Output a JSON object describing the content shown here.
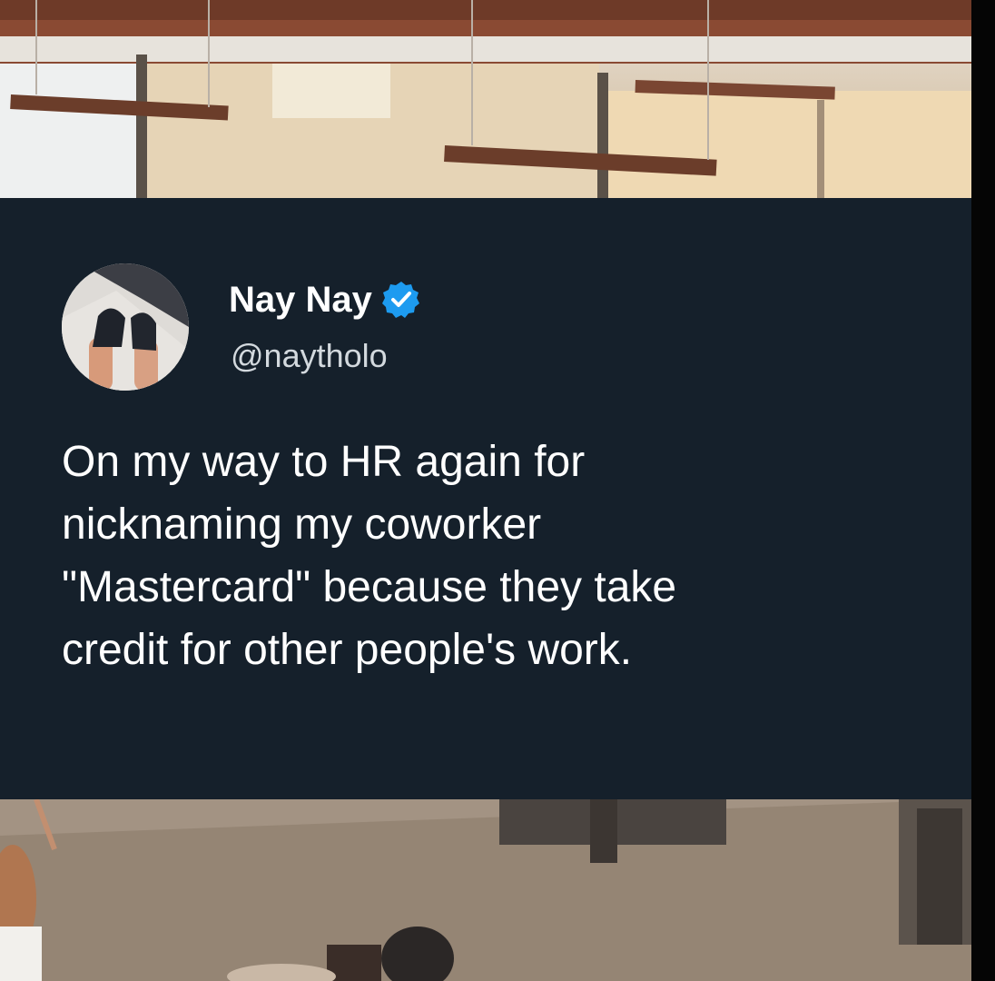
{
  "tweet": {
    "display_name": "Nay Nay",
    "handle": "@naytholo",
    "verified": true,
    "text": "On my way to HR again for\nnicknaming my coworker\n\"Mastercard\" because they take\ncredit for other people's work."
  },
  "colors": {
    "card_background": "#15202b",
    "verified_badge": "#1d9bf0",
    "text_primary": "#ffffff",
    "text_secondary": "#d3d9de"
  },
  "icons": {
    "verified": "verified-badge-icon",
    "avatar": "profile-photo"
  }
}
